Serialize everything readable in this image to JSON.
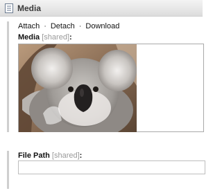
{
  "header": {
    "title": "Media",
    "icon": "document-icon"
  },
  "actions": {
    "attach": "Attach",
    "separator": "·",
    "detach": "Detach",
    "download": "Download"
  },
  "media_field": {
    "label": "Media",
    "shared": "[shared]",
    "colon": ":",
    "image": {
      "subject": "koala photo"
    }
  },
  "file_path_field": {
    "label": "File Path",
    "shared": "[shared]",
    "colon": ":",
    "value": ""
  }
}
